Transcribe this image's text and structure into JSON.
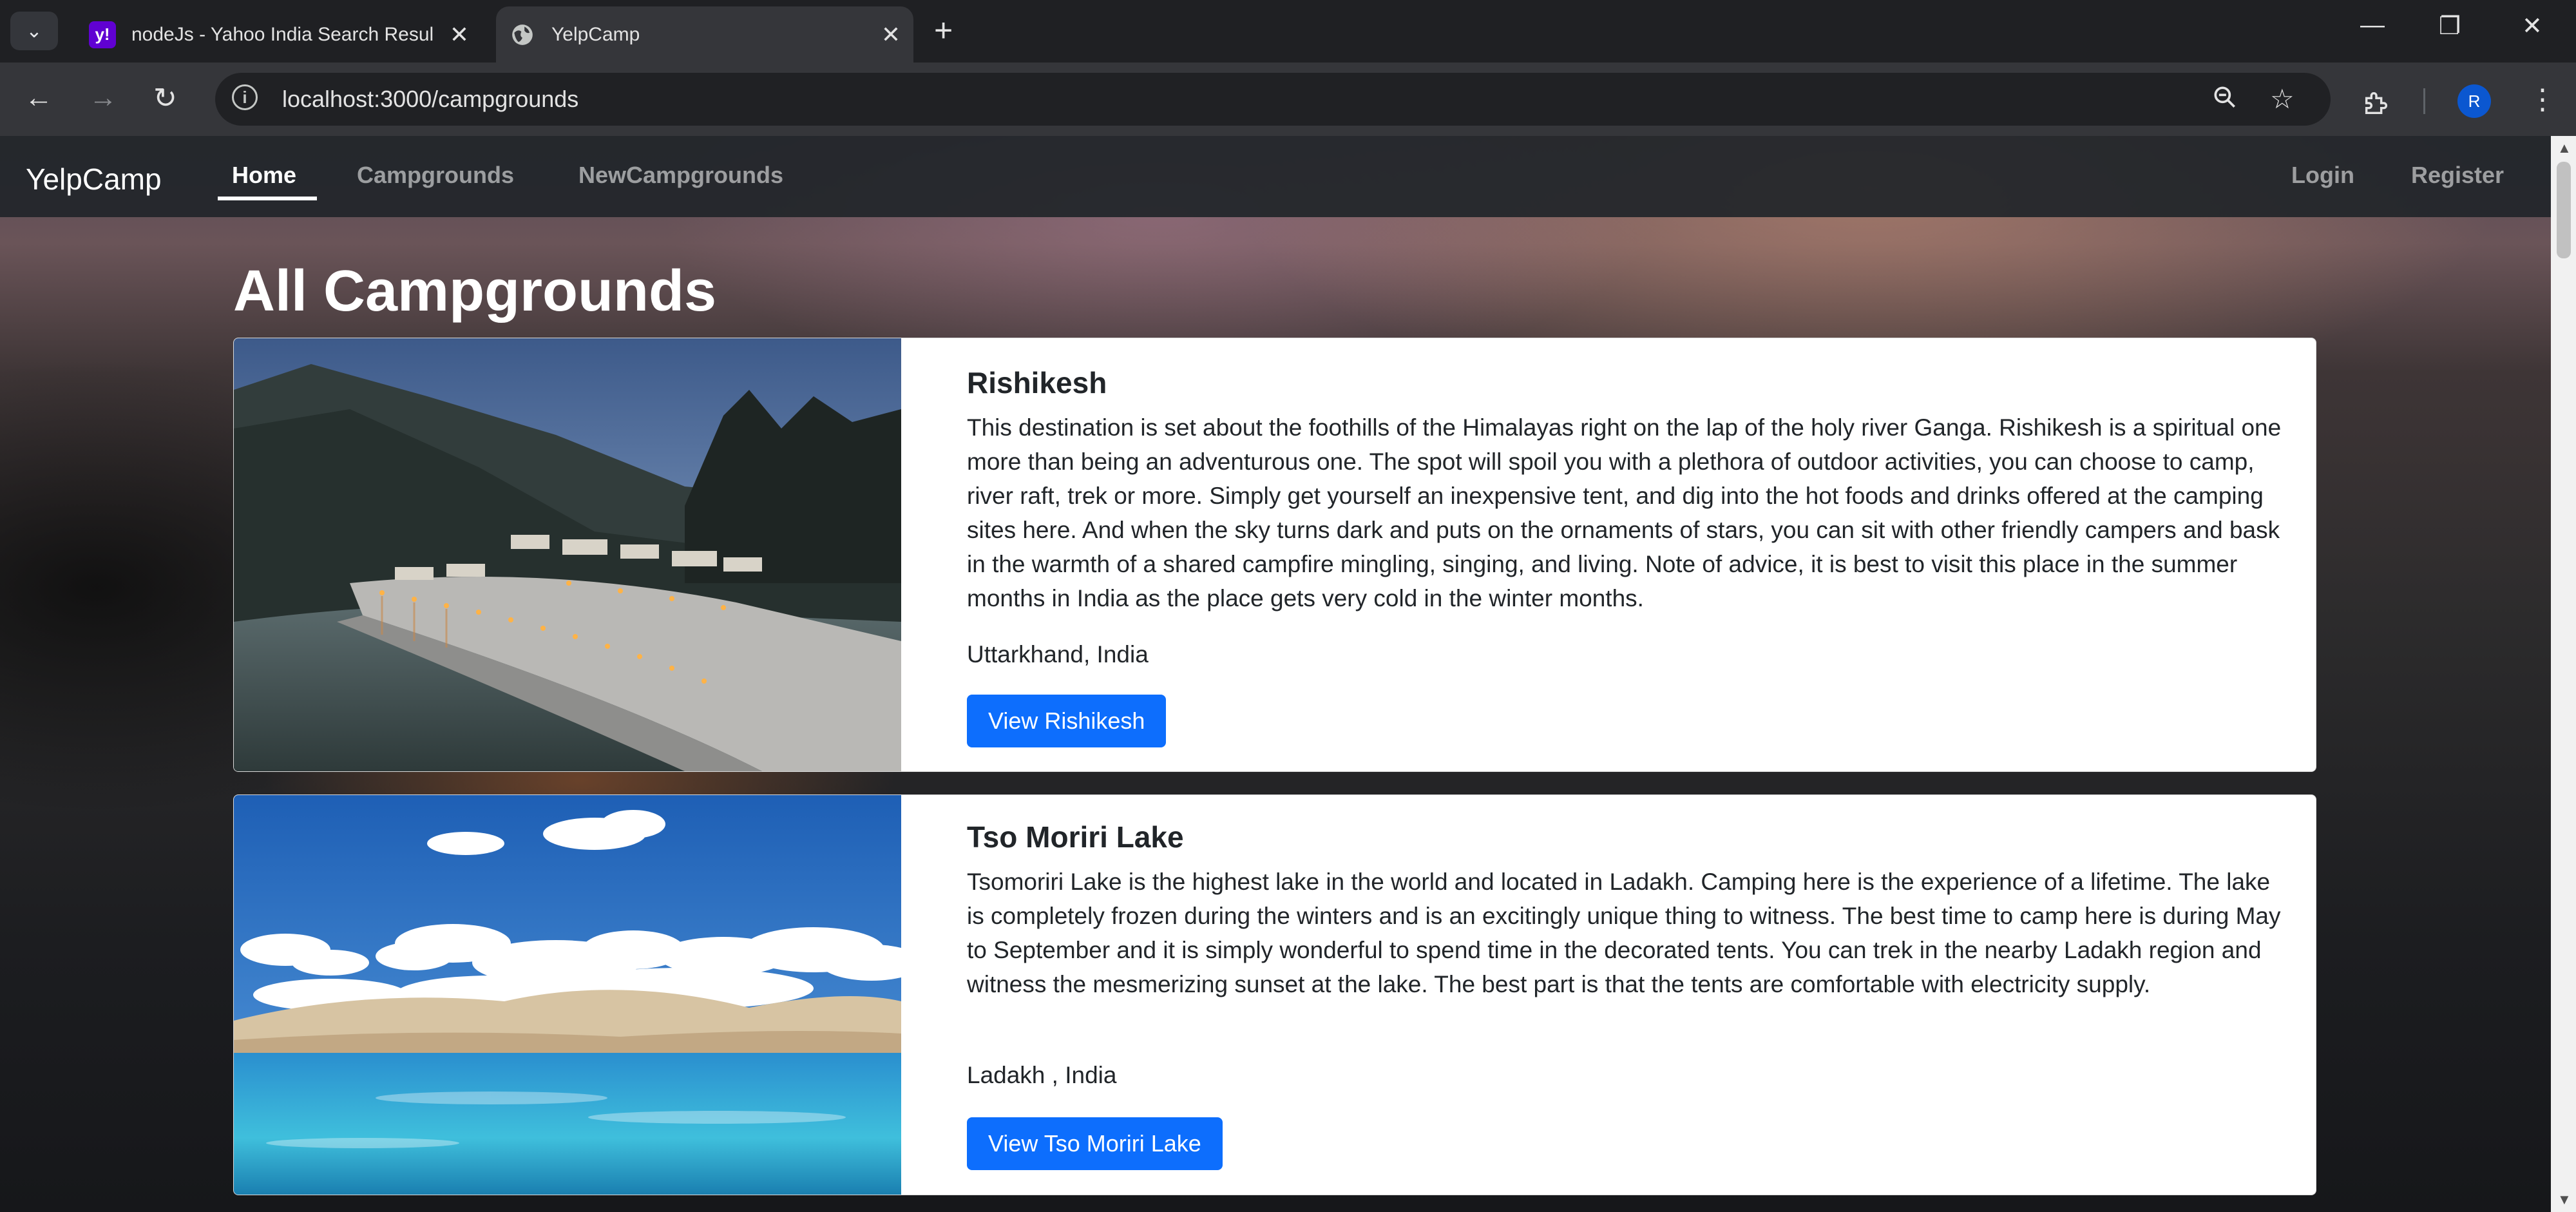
{
  "browser": {
    "tabs": [
      {
        "title": "nodeJs - Yahoo India Search Resul",
        "favicon": "yahoo-icon",
        "favicon_text": "y!"
      },
      {
        "title": "YelpCamp",
        "favicon": "globe-icon"
      }
    ],
    "url": "localhost:3000/campgrounds",
    "profile_initial": "R"
  },
  "site": {
    "brand": "YelpCamp",
    "nav": {
      "home": "Home",
      "campgrounds": "Campgrounds",
      "new": "NewCampgrounds",
      "login": "Login",
      "register": "Register"
    },
    "page_title": "All Campgrounds",
    "campgrounds": [
      {
        "title": "Rishikesh",
        "description": "This destination is set about the foothills of the Himalayas right on the lap of the holy river Ganga. Rishikesh is a spiritual one more than being an adventurous one. The spot will spoil you with a plethora of outdoor activities, you can choose to camp, river raft, trek or more. Simply get yourself an inexpensive tent, and dig into the hot foods and drinks offered at the camping sites here. And when the sky turns dark and puts on the ornaments of stars, you can sit with other friendly campers and bask in the warmth of a shared campfire mingling, singing, and living. Note of advice, it is best to visit this place in the summer months in India as the place gets very cold in the winter months.",
        "location": "Uttarkhand, India",
        "button": "View Rishikesh"
      },
      {
        "title": "Tso Moriri Lake",
        "description": "Tsomoriri Lake is the highest lake in the world and located in Ladakh. Camping here is the experience of a lifetime. The lake is completely frozen during the winters and is an excitingly unique thing to witness. The best time to camp here is during May to September and it is simply wonderful to spend time in the decorated tents. You can trek in the nearby Ladakh region and witness the mesmerizing sunset at the lake. The best part is that the tents are comfortable with electricity supply.",
        "location": "Ladakh , India",
        "button": "View Tso Moriri Lake"
      }
    ]
  },
  "colors": {
    "primary_button": "#0d6efd",
    "navbar": "#212529",
    "chrome_dark": "#1f2023",
    "chrome_toolbar": "#35363a"
  }
}
